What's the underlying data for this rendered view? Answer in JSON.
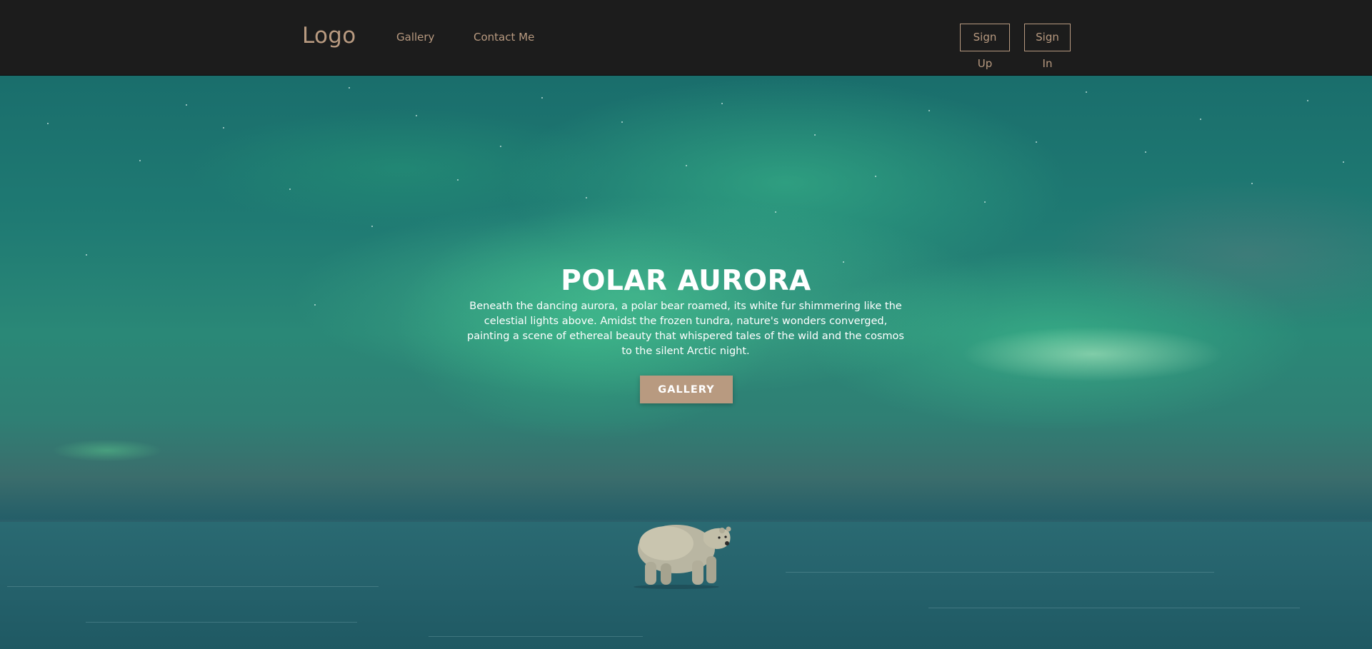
{
  "header": {
    "logo": "Logo",
    "nav": {
      "gallery": "Gallery",
      "contact": "Contact Me"
    },
    "auth": {
      "sign_up": "Sign Up",
      "sign_in": "Sign In"
    }
  },
  "hero": {
    "title": "POLAR AURORA",
    "description": "Beneath the dancing aurora, a polar bear roamed, its white fur shimmering like the celestial lights above. Amidst the frozen tundra, nature's wonders converged, painting a scene of ethereal beauty that whispered tales of the wild and the cosmos to the silent Arctic night.",
    "cta": "GALLERY"
  },
  "colors": {
    "header_bg": "#1c1c1c",
    "accent": "#b89a80",
    "hero_text": "#ffffff"
  },
  "icons": [
    "polar-bear-illustration"
  ]
}
